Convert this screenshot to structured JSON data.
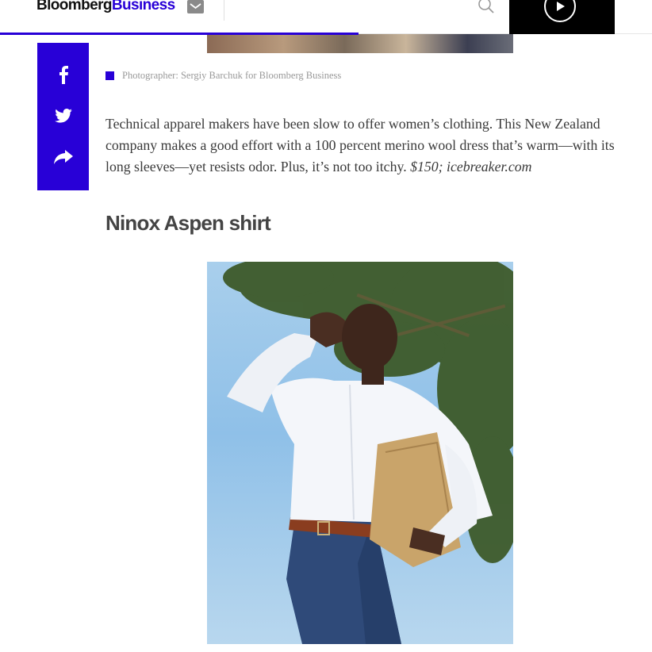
{
  "header": {
    "logo_part1": "Bloomberg",
    "logo_part2": "Business",
    "mail_icon": "mail-icon",
    "search_icon": "search-icon",
    "video_icon": "play-icon"
  },
  "share": {
    "items": [
      {
        "icon": "facebook-icon"
      },
      {
        "icon": "twitter-icon"
      },
      {
        "icon": "share-icon"
      }
    ]
  },
  "article": {
    "caption": "Photographer: Sergiy Barchuk for Bloomberg Business",
    "body_main": "Technical apparel makers have been slow to offer women’s clothing. This New Zealand company makes a good effort with a 100 percent merino wool dress that’s warm—with its long sleeves—yet resists odor. Plus, it’s not too itchy. ",
    "body_price": "$150; icebreaker.com",
    "section_title": "Ninox Aspen shirt"
  },
  "colors": {
    "brand": "#2800d7",
    "text": "#3a3a3a",
    "caption": "#999999"
  }
}
